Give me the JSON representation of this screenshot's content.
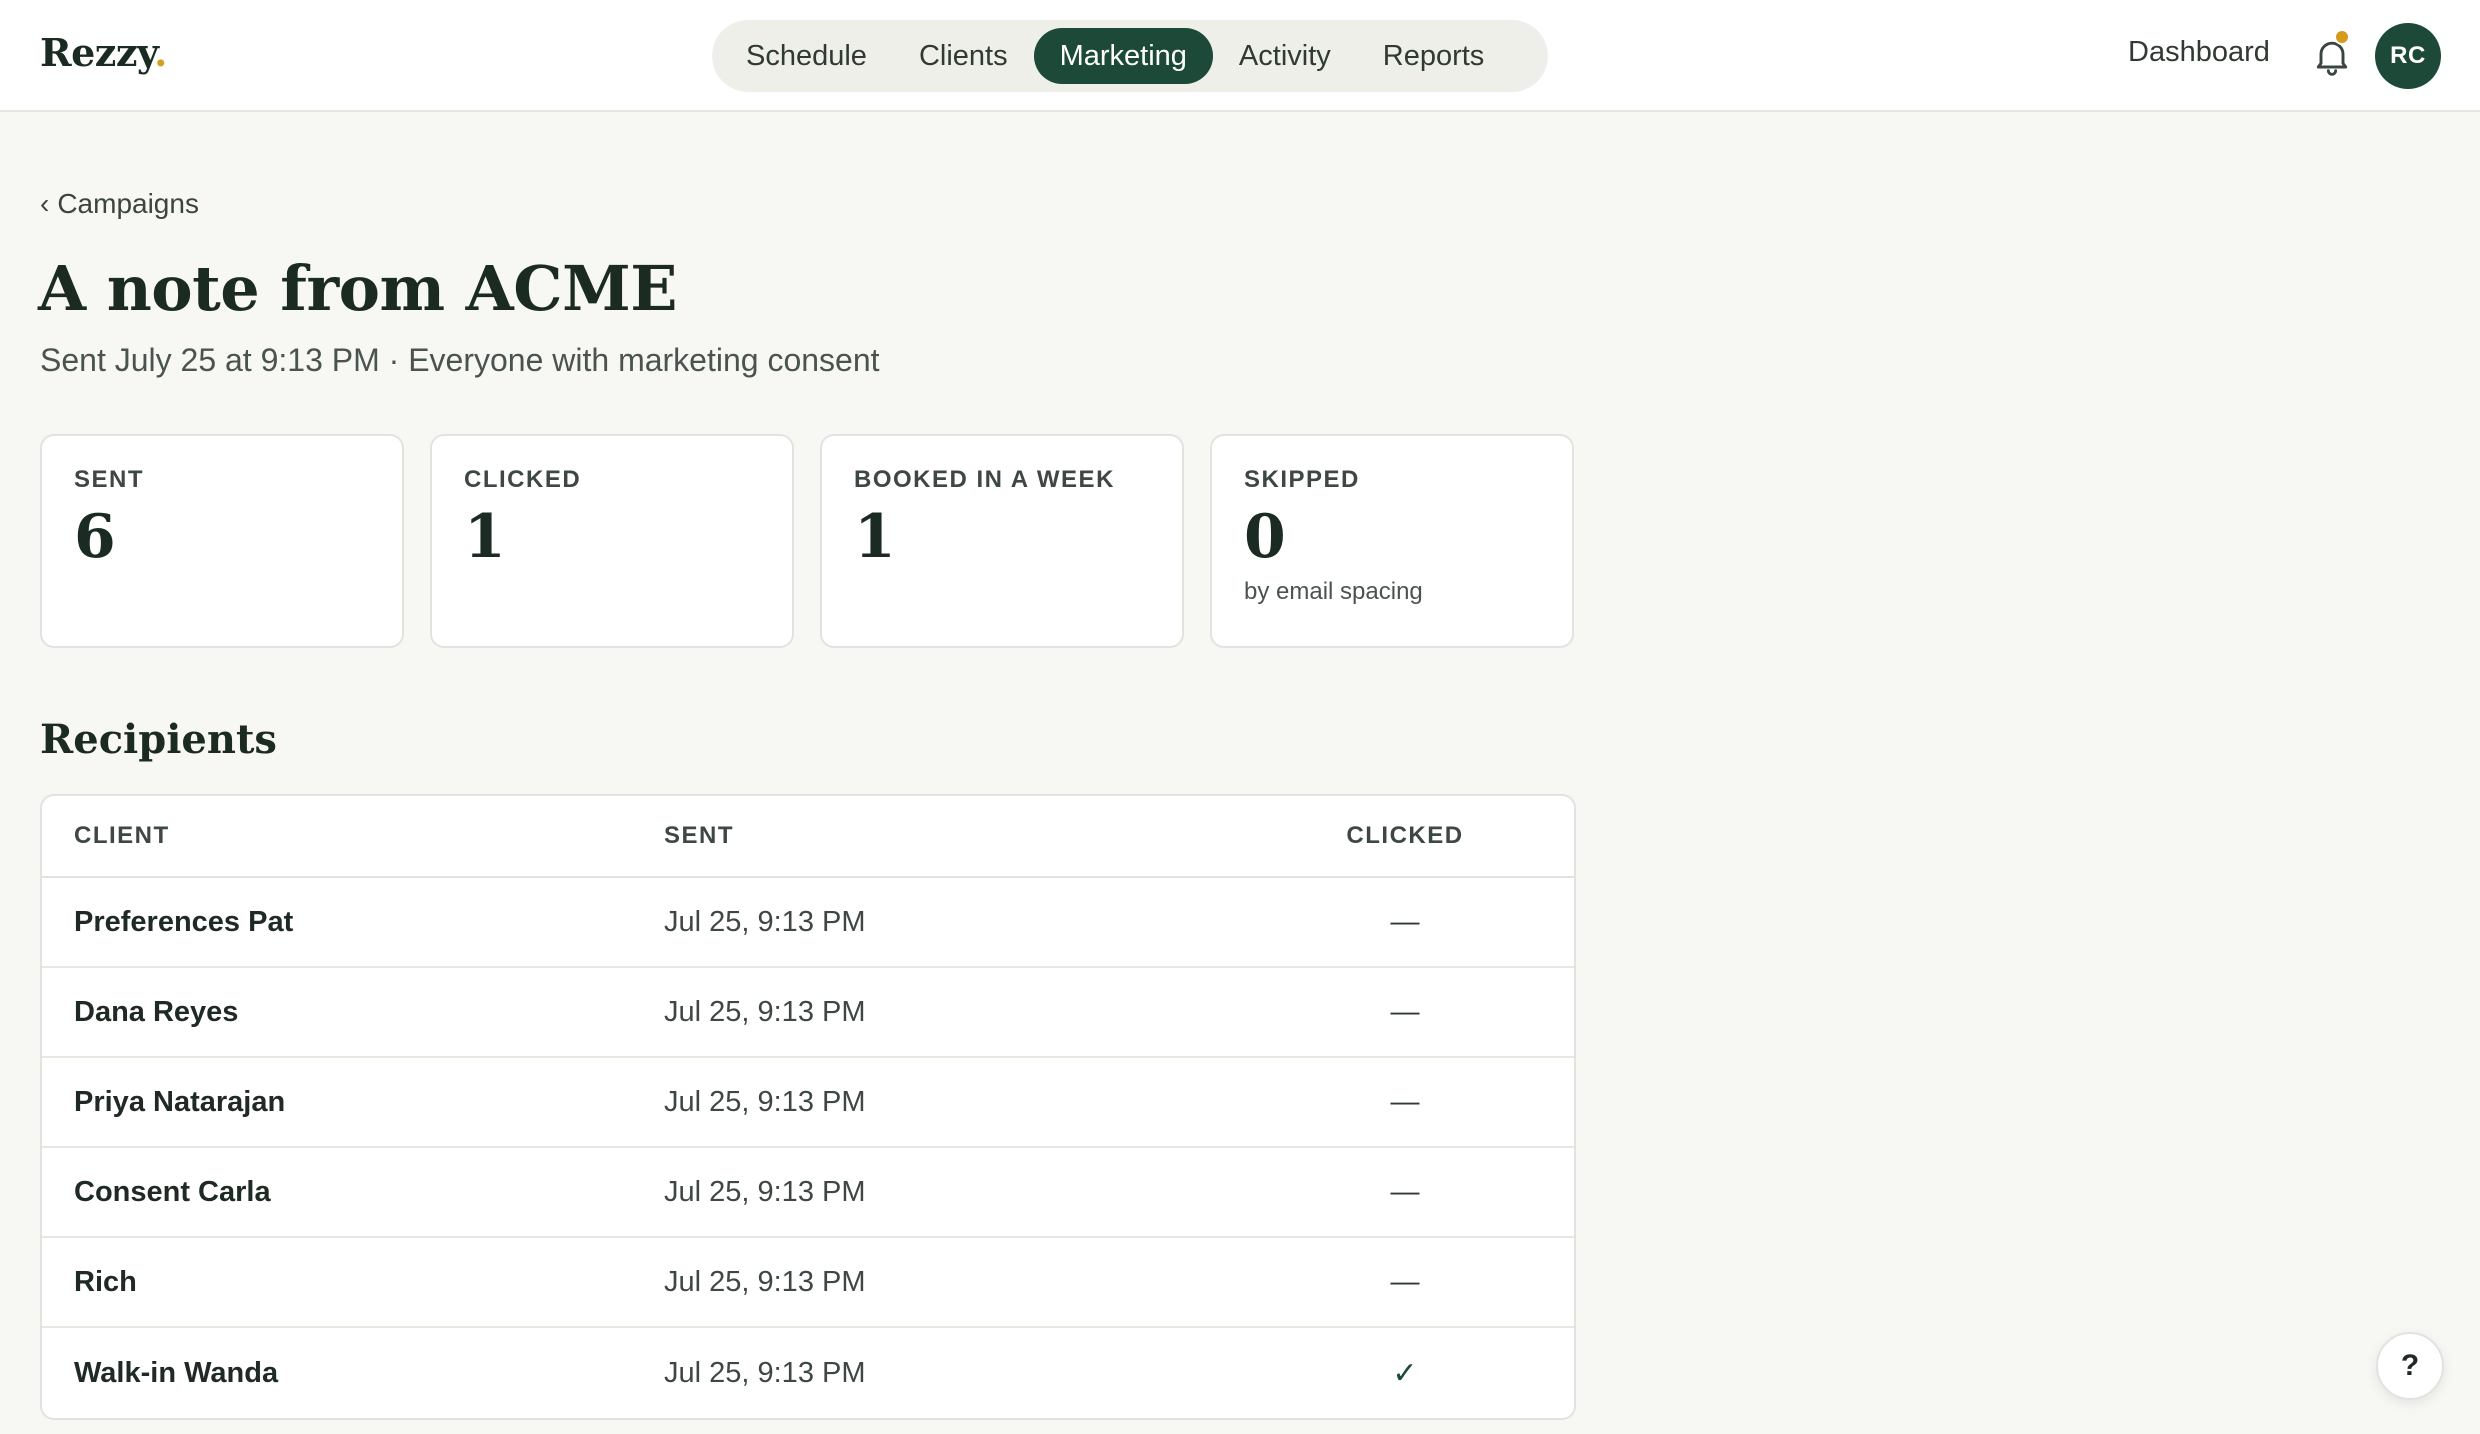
{
  "app": {
    "logo_text": "Rezzy",
    "logo_dot": "."
  },
  "nav": {
    "items": [
      {
        "label": "Schedule",
        "active": false
      },
      {
        "label": "Clients",
        "active": false
      },
      {
        "label": "Marketing",
        "active": true
      },
      {
        "label": "Activity",
        "active": false
      },
      {
        "label": "Reports",
        "active": false
      }
    ],
    "dashboard_label": "Dashboard",
    "bell_icon": "bell-icon",
    "avatar_initials": "RC"
  },
  "breadcrumb": {
    "chevron": "‹",
    "label": "Campaigns"
  },
  "campaign": {
    "title": "A note from ACME",
    "subtitle": "Sent July 25 at 9:13 PM · Everyone with marketing consent"
  },
  "stats": [
    {
      "label": "SENT",
      "value": "6",
      "note": ""
    },
    {
      "label": "CLICKED",
      "value": "1",
      "note": ""
    },
    {
      "label": "BOOKED IN A WEEK",
      "value": "1",
      "note": ""
    },
    {
      "label": "SKIPPED",
      "value": "0",
      "note": "by email spacing"
    }
  ],
  "recipients": {
    "title": "Recipients",
    "headers": {
      "client": "CLIENT",
      "sent": "SENT",
      "clicked": "CLICKED"
    },
    "rows": [
      {
        "client": "Preferences Pat",
        "sent": "Jul 25, 9:13 PM",
        "clicked": "—"
      },
      {
        "client": "Dana Reyes",
        "sent": "Jul 25, 9:13 PM",
        "clicked": "—"
      },
      {
        "client": "Priya Natarajan",
        "sent": "Jul 25, 9:13 PM",
        "clicked": "—"
      },
      {
        "client": "Consent Carla",
        "sent": "Jul 25, 9:13 PM",
        "clicked": "—"
      },
      {
        "client": "Rich",
        "sent": "Jul 25, 9:13 PM",
        "clicked": "—"
      },
      {
        "client": "Walk-in Wanda",
        "sent": "Jul 25, 9:13 PM",
        "clicked": "✓"
      }
    ]
  },
  "help": {
    "label": "?"
  },
  "colors": {
    "brand": "#1d4a38",
    "accent": "#d3a025",
    "background": "#f7f7f4"
  }
}
